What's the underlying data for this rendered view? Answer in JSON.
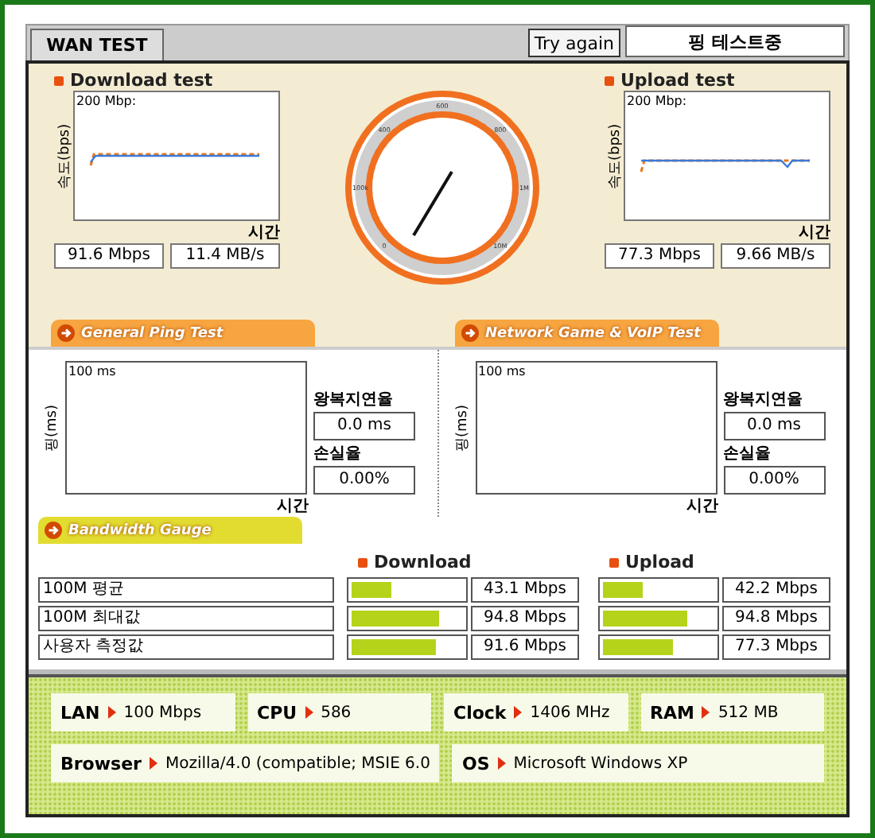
{
  "tab": {
    "label": "WAN TEST",
    "selected": true
  },
  "retry_button": "Try again",
  "status": "핑 테스트중",
  "speed_tests": [
    {
      "title": "Download test",
      "scale": "200 Mbp:",
      "axis": "속도(bps)",
      "time_label": "시간",
      "mbps": "91.6 Mbps",
      "mbs": "11.4 MB/s"
    },
    {
      "title": "Upload test",
      "scale": "200 Mbp:",
      "axis": "속도(bps)",
      "time_label": "시간",
      "mbps": "77.3 Mbps",
      "mbs": "9.66 MB/s"
    }
  ],
  "gauge_labels": [
    "0",
    "100k",
    "400",
    "600",
    "800",
    "1M",
    "10M"
  ],
  "ping_sections": [
    {
      "title": "General Ping Test",
      "scale": "100 ms",
      "axis": "핑(ms)",
      "time_label": "시간",
      "latency_label": "왕복지연율",
      "latency": "0.0 ms",
      "loss_label": "손실율",
      "loss": "0.00%"
    },
    {
      "title": "Network Game & VoIP Test",
      "scale": "100 ms",
      "axis": "핑(ms)",
      "time_label": "시간",
      "latency_label": "왕복지연율",
      "latency": "0.0 ms",
      "loss_label": "손실율",
      "loss": "0.00%"
    }
  ],
  "bandwidth": {
    "title": "Bandwidth Gauge",
    "download_label": "Download",
    "upload_label": "Upload",
    "rows": [
      {
        "label": "100M 평균",
        "download": {
          "level": 0.35,
          "reading": "43.1 Mbps"
        },
        "upload": {
          "level": 0.35,
          "reading": "42.2 Mbps"
        }
      },
      {
        "label": "100M 최대값",
        "download": {
          "level": 0.78,
          "reading": "94.8 Mbps"
        },
        "upload": {
          "level": 0.76,
          "reading": "94.8 Mbps"
        }
      },
      {
        "label": "사용자 측정값",
        "download": {
          "level": 0.75,
          "reading": "91.6 Mbps"
        },
        "upload": {
          "level": 0.63,
          "reading": "77.3 Mbps"
        }
      }
    ]
  },
  "system_info": [
    [
      {
        "key": "LAN",
        "value": "100 Mbps"
      },
      {
        "key": "CPU",
        "value": "586"
      },
      {
        "key": "Clock",
        "value": "1406 MHz"
      },
      {
        "key": "RAM",
        "value": "512 MB"
      }
    ],
    [
      {
        "key": "Browser",
        "value": "Mozilla/4.0 (compatible; MSIE 6.0"
      },
      {
        "key": "OS",
        "value": "Microsoft Windows XP"
      }
    ]
  ]
}
